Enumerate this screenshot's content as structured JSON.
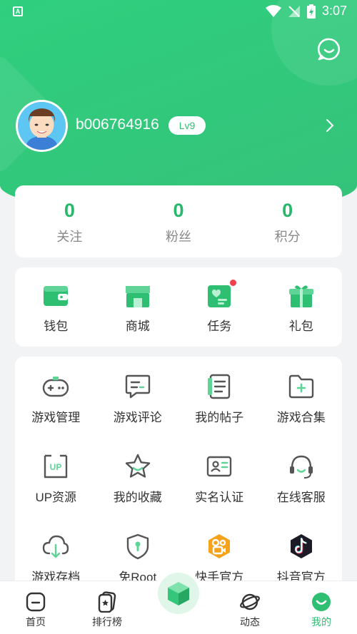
{
  "status_bar": {
    "time": "3:07",
    "app_badge": "A"
  },
  "profile": {
    "username": "b006764916",
    "level": "Lv9"
  },
  "stats": [
    {
      "value": "0",
      "label": "关注"
    },
    {
      "value": "0",
      "label": "粉丝"
    },
    {
      "value": "0",
      "label": "积分"
    }
  ],
  "quick": [
    {
      "label": "钱包",
      "icon": "wallet-icon"
    },
    {
      "label": "商城",
      "icon": "store-icon"
    },
    {
      "label": "任务",
      "icon": "task-icon",
      "has_dot": true
    },
    {
      "label": "礼包",
      "icon": "gift-icon"
    }
  ],
  "grid": [
    {
      "label": "游戏管理",
      "icon": "gamepad-icon"
    },
    {
      "label": "游戏评论",
      "icon": "comment-icon"
    },
    {
      "label": "我的帖子",
      "icon": "posts-icon"
    },
    {
      "label": "游戏合集",
      "icon": "folder-add-icon"
    },
    {
      "label": "UP资源",
      "icon": "up-icon"
    },
    {
      "label": "我的收藏",
      "icon": "star-icon"
    },
    {
      "label": "实名认证",
      "icon": "id-card-icon"
    },
    {
      "label": "在线客服",
      "icon": "headset-icon"
    },
    {
      "label": "游戏存档",
      "icon": "cloud-download-icon"
    },
    {
      "label": "免Root",
      "icon": "shield-icon"
    },
    {
      "label": "快手官方",
      "icon": "kuaishou-icon"
    },
    {
      "label": "抖音官方",
      "icon": "douyin-icon"
    }
  ],
  "nav": [
    {
      "label": "首页",
      "icon": "home-icon"
    },
    {
      "label": "排行榜",
      "icon": "ranking-icon"
    },
    {
      "label": "",
      "icon": "cube-icon"
    },
    {
      "label": "动态",
      "icon": "planet-icon"
    },
    {
      "label": "我的",
      "icon": "me-icon",
      "active": true
    }
  ],
  "colors": {
    "accent": "#2fbf73",
    "header": "#35c27a",
    "dot": "#f0404c"
  }
}
